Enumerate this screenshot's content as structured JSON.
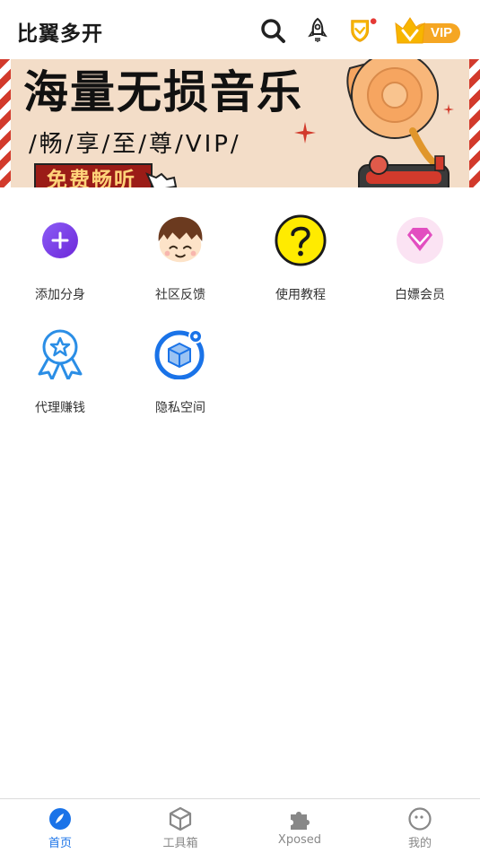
{
  "header": {
    "title": "比翼多开",
    "icons": [
      "search-icon",
      "rocket-icon",
      "shield-badge-icon",
      "vip-crown-icon"
    ],
    "vip_label": "VIP",
    "notification_dot_color": "#e53935"
  },
  "banner": {
    "title": "海量无损音乐",
    "subtitle": "/畅/享/至/尊/VIP/",
    "button_label": "免费畅听"
  },
  "grid": {
    "items": [
      {
        "label": "添加分身",
        "icon": "add-circle-icon"
      },
      {
        "label": "社区反馈",
        "icon": "cartoon-face-icon"
      },
      {
        "label": "使用教程",
        "icon": "question-mark-icon"
      },
      {
        "label": "白嫖会员",
        "icon": "diamond-icon"
      },
      {
        "label": "代理赚钱",
        "icon": "award-ribbon-icon"
      },
      {
        "label": "隐私空间",
        "icon": "private-box-icon"
      }
    ]
  },
  "tabbar": {
    "items": [
      {
        "label": "首页",
        "icon": "home-icon",
        "active": true
      },
      {
        "label": "工具箱",
        "icon": "toolbox-cube-icon",
        "active": false
      },
      {
        "label": "Xposed",
        "icon": "puzzle-icon",
        "active": false
      },
      {
        "label": "我的",
        "icon": "profile-face-icon",
        "active": false
      }
    ]
  },
  "colors": {
    "accent": "#1a73e8",
    "vip_orange": "#f5a623",
    "banner_bg": "#f3ddc8",
    "banner_button": "#9b1c17"
  }
}
